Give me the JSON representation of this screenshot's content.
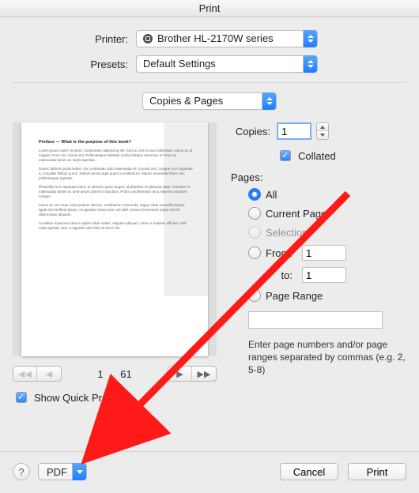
{
  "window": {
    "title": "Print"
  },
  "printer": {
    "label": "Printer:",
    "selected": "Brother HL-2170W series"
  },
  "presets": {
    "label": "Presets:",
    "selected": "Default Settings"
  },
  "section": {
    "selected": "Copies & Pages"
  },
  "copies": {
    "label": "Copies:",
    "value": "1",
    "collated_label": "Collated"
  },
  "pages": {
    "label": "Pages:",
    "options": {
      "all": "All",
      "current": "Current Page",
      "selection": "Selection",
      "from": "From:",
      "to": "to:",
      "range": "Page Range"
    },
    "from_value": "1",
    "to_value": "1",
    "range_value": "",
    "hint": "Enter page numbers and/or page ranges separated by commas (e.g. 2, 5-8)"
  },
  "preview": {
    "page_indicator_prefix": "1",
    "page_indicator_suffix": "61",
    "show_label": "Show Quick Preview",
    "doc_title": "Preface — What is the purpose of this book?"
  },
  "footer": {
    "help": "?",
    "pdf": "PDF",
    "cancel": "Cancel",
    "print": "Print"
  }
}
